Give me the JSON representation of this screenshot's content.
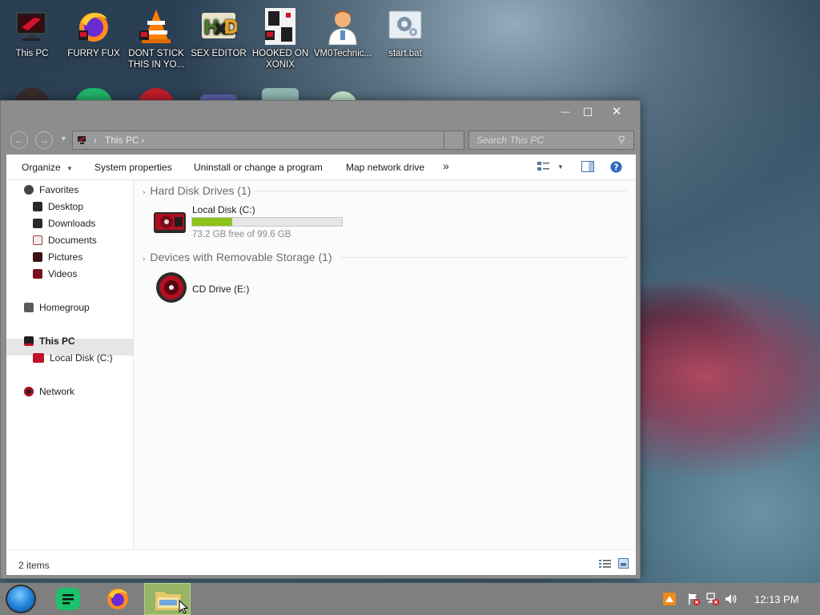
{
  "desktop_icons": [
    {
      "label": "This PC",
      "icon": "this-pc-icon"
    },
    {
      "label": "FURRY FUX",
      "icon": "firefox-icon"
    },
    {
      "label": "DONT STICK THIS IN YO...",
      "icon": "vlc-cone-icon"
    },
    {
      "label": "SEX EDITOR",
      "icon": "hxd-editor-icon"
    },
    {
      "label": "HOOKED ON XONIX",
      "icon": "xonix-game-icon"
    },
    {
      "label": "VM0Technic...",
      "icon": "doctor-avatar-icon"
    },
    {
      "label": "start.bat",
      "icon": "batch-file-icon"
    }
  ],
  "window": {
    "controls": {
      "minimize": "—",
      "maximize": "☐",
      "close": "✕"
    },
    "address": {
      "root_sep": "›",
      "location": "This PC",
      "trail_sep": "›"
    },
    "search": {
      "placeholder": "Search This PC"
    },
    "toolbar": {
      "organize": "Organize",
      "system_properties": "System properties",
      "uninstall": "Uninstall or change a program",
      "map_drive": "Map network drive",
      "more": "»"
    },
    "nav": {
      "favorites": "Favorites",
      "desktop": "Desktop",
      "downloads": "Downloads",
      "documents": "Documents",
      "pictures": "Pictures",
      "videos": "Videos",
      "homegroup": "Homegroup",
      "this_pc": "This PC",
      "local_disk": "Local Disk (C:)",
      "network": "Network"
    },
    "groups": {
      "hard_disks": "Hard Disk Drives (1)",
      "removable": "Devices with Removable Storage (1)"
    },
    "drives": {
      "c_label": "Local Disk (C:)",
      "c_space": "73.2 GB free of 99.6 GB",
      "c_used_fraction": 0.265,
      "e_label": "CD Drive (E:)"
    },
    "status": {
      "items": "2 items"
    }
  },
  "taskbar": {
    "clock": "12:13 PM"
  },
  "colors": {
    "drive_bar": "#8cc21b",
    "window_frame": "#8d8d8d",
    "taskbar": "#7f7f7f"
  }
}
